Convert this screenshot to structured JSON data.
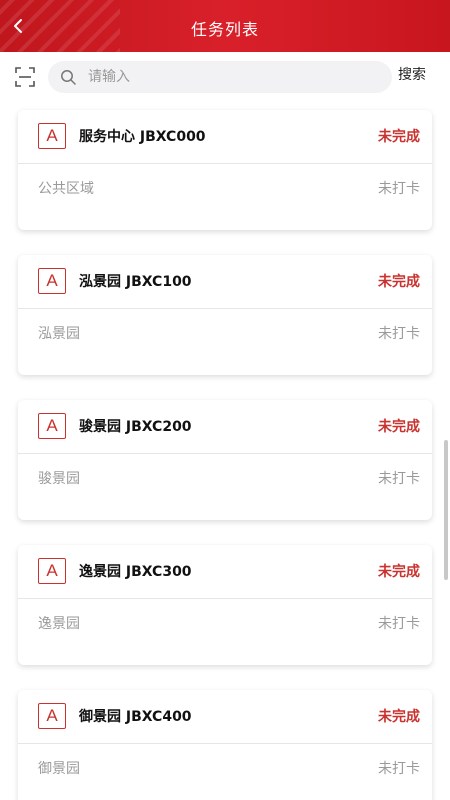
{
  "header": {
    "title": "任务列表",
    "back_icon": "chevron-left-icon"
  },
  "search": {
    "placeholder": "请输入",
    "value": "",
    "button_label": "搜索",
    "scan_icon": "scan-icon",
    "search_icon": "search-icon"
  },
  "tasks": [
    {
      "badge": "A",
      "name": "服务中心 JBXC000",
      "status": "未完成",
      "area": "公共区域",
      "checkin": "未打卡"
    },
    {
      "badge": "A",
      "name": "泓景园 JBXC100",
      "status": "未完成",
      "area": "泓景园",
      "checkin": "未打卡"
    },
    {
      "badge": "A",
      "name": "骏景园 JBXC200",
      "status": "未完成",
      "area": "骏景园",
      "checkin": "未打卡"
    },
    {
      "badge": "A",
      "name": "逸景园 JBXC300",
      "status": "未完成",
      "area": "逸景园",
      "checkin": "未打卡"
    },
    {
      "badge": "A",
      "name": "御景园 JBXC400",
      "status": "未完成",
      "area": "御景园",
      "checkin": "未打卡"
    }
  ],
  "colors": {
    "brand": "#d11b23",
    "status": "#c9322e",
    "muted": "#9a9a9a"
  }
}
